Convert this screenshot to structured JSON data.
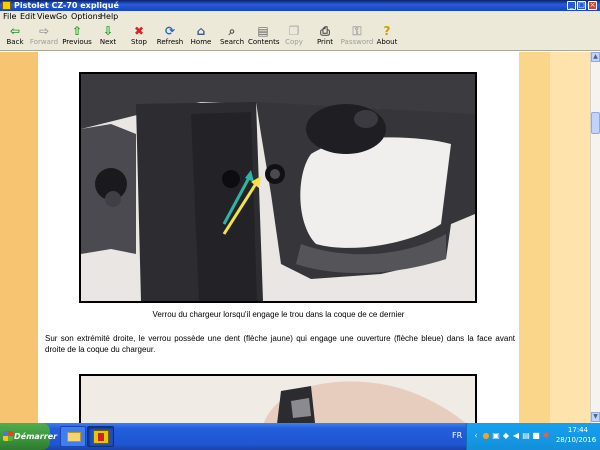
{
  "window": {
    "title": "Pistolet CZ-70 expliqué"
  },
  "menu": [
    "File",
    "Edit",
    "View",
    "Go",
    "Options",
    "Help"
  ],
  "toolbar": [
    {
      "label": "Back",
      "icon": "back-arrow-icon",
      "glyph": "⇦",
      "color": "#2a8a2a",
      "enabled": true
    },
    {
      "label": "Forward",
      "icon": "forward-arrow-icon",
      "glyph": "⇨",
      "color": "#9a9a9a",
      "enabled": false
    },
    {
      "label": "Previous",
      "icon": "up-arrow-icon",
      "glyph": "⇧",
      "color": "#1f9a1f",
      "enabled": true
    },
    {
      "label": "Next",
      "icon": "down-arrow-icon",
      "glyph": "⇩",
      "color": "#1f9a1f",
      "enabled": true
    },
    {
      "label": "Stop",
      "icon": "stop-icon",
      "glyph": "✖",
      "color": "#d22",
      "enabled": true
    },
    {
      "label": "Refresh",
      "icon": "refresh-icon",
      "glyph": "⟳",
      "color": "#2a6acc",
      "enabled": true
    },
    {
      "label": "Home",
      "icon": "home-icon",
      "glyph": "⌂",
      "color": "#3a5a8a",
      "enabled": true
    },
    {
      "label": "Search",
      "icon": "search-icon",
      "glyph": "⌕",
      "color": "#555",
      "enabled": true
    },
    {
      "label": "Contents",
      "icon": "contents-icon",
      "glyph": "▤",
      "color": "#666",
      "enabled": true
    },
    {
      "label": "Copy",
      "icon": "copy-icon",
      "glyph": "❐",
      "color": "#aaa",
      "enabled": false
    },
    {
      "label": "Print",
      "icon": "print-icon",
      "glyph": "⎙",
      "color": "#444",
      "enabled": true
    },
    {
      "label": "Password",
      "icon": "key-icon",
      "glyph": "⚿",
      "color": "#aaa",
      "enabled": false
    },
    {
      "label": "About",
      "icon": "about-icon",
      "glyph": "?",
      "color": "#c9a000",
      "enabled": true
    }
  ],
  "content": {
    "caption": "Verrou du chargeur lorsqu'il engage le trou dans la coque de ce dernier",
    "paragraph": "Sur son extrémité droite, le verrou possède une dent (flèche jaune) qui engage une ouverture (flèche bleue) dans la face avant droite de la coque du chargeur."
  },
  "taskbar": {
    "start_label": "Démarrer",
    "language": "FR",
    "time": "17:44",
    "date": "28/10/2016"
  },
  "colors": {
    "arrow_yellow": "#f2e34a",
    "arrow_blue": "#2bb5a5"
  }
}
